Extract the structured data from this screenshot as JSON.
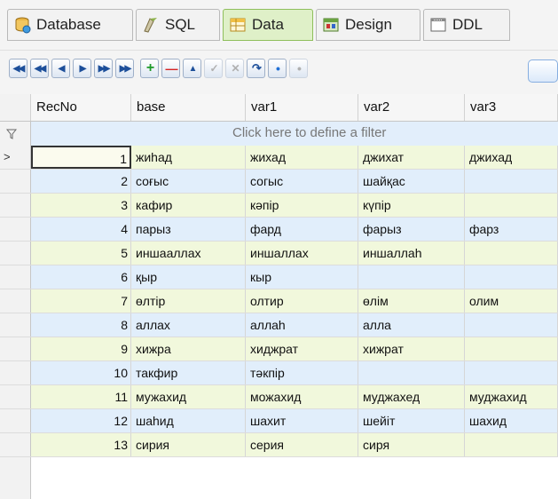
{
  "tabs": [
    {
      "label": "Database",
      "icon": "database-icon"
    },
    {
      "label": "SQL",
      "icon": "sql-icon"
    },
    {
      "label": "Data",
      "icon": "data-grid-icon",
      "active": true
    },
    {
      "label": "Design",
      "icon": "design-icon"
    },
    {
      "label": "DDL",
      "icon": "ddl-icon"
    }
  ],
  "navigator": {
    "buttons": [
      {
        "name": "first-record-button",
        "glyph": "◀◀"
      },
      {
        "name": "prior-page-button",
        "glyph": "◀◀"
      },
      {
        "name": "prior-record-button",
        "glyph": "◀"
      },
      {
        "name": "next-record-button",
        "glyph": "▶"
      },
      {
        "name": "next-page-button",
        "glyph": "▶▶"
      },
      {
        "name": "last-record-button",
        "glyph": "▶▶"
      },
      {
        "name": "insert-record-button",
        "glyph": "+"
      },
      {
        "name": "delete-record-button",
        "glyph": "—"
      },
      {
        "name": "edit-record-button",
        "glyph": "▲"
      },
      {
        "name": "post-edit-button",
        "glyph": "✓"
      },
      {
        "name": "cancel-edit-button",
        "glyph": "✕"
      },
      {
        "name": "refresh-button",
        "glyph": "↷"
      },
      {
        "name": "bookmark-add-button",
        "glyph": "•"
      },
      {
        "name": "bookmark-goto-button",
        "glyph": "•"
      }
    ]
  },
  "grid": {
    "columns": [
      "RecNo",
      "base",
      "var1",
      "var2",
      "var3"
    ],
    "filter_text": "Click here to define a filter",
    "current_row_indicator": ">",
    "rows": [
      {
        "recno": "1",
        "base": "жиһад",
        "var1": "жихад",
        "var2": "джихат",
        "var3": "джихад"
      },
      {
        "recno": "2",
        "base": "соғыс",
        "var1": "согыс",
        "var2": "шайқас",
        "var3": ""
      },
      {
        "recno": "3",
        "base": "кафир",
        "var1": "кәпір",
        "var2": "күпір",
        "var3": ""
      },
      {
        "recno": "4",
        "base": "парыз",
        "var1": "фард",
        "var2": "фарыз",
        "var3": "фарз"
      },
      {
        "recno": "5",
        "base": "иншааллах",
        "var1": "иншаллах",
        "var2": "иншаллаһ",
        "var3": ""
      },
      {
        "recno": "6",
        "base": "қыр",
        "var1": "кыр",
        "var2": "",
        "var3": ""
      },
      {
        "recno": "7",
        "base": "өлтір",
        "var1": "олтир",
        "var2": "өлім",
        "var3": "олим"
      },
      {
        "recno": "8",
        "base": "аллах",
        "var1": "аллаһ",
        "var2": "алла",
        "var3": ""
      },
      {
        "recno": "9",
        "base": "хижра",
        "var1": "хиджрат",
        "var2": "хижрат",
        "var3": ""
      },
      {
        "recno": "10",
        "base": "такфир",
        "var1": "тәкпір",
        "var2": "",
        "var3": ""
      },
      {
        "recno": "11",
        "base": "мужахид",
        "var1": "можахид",
        "var2": "муджахед",
        "var3": "муджахид"
      },
      {
        "recno": "12",
        "base": "шаһид",
        "var1": "шахит",
        "var2": "шейіт",
        "var3": "шахид"
      },
      {
        "recno": "13",
        "base": "сирия",
        "var1": "серия",
        "var2": "сиря",
        "var3": ""
      }
    ]
  }
}
